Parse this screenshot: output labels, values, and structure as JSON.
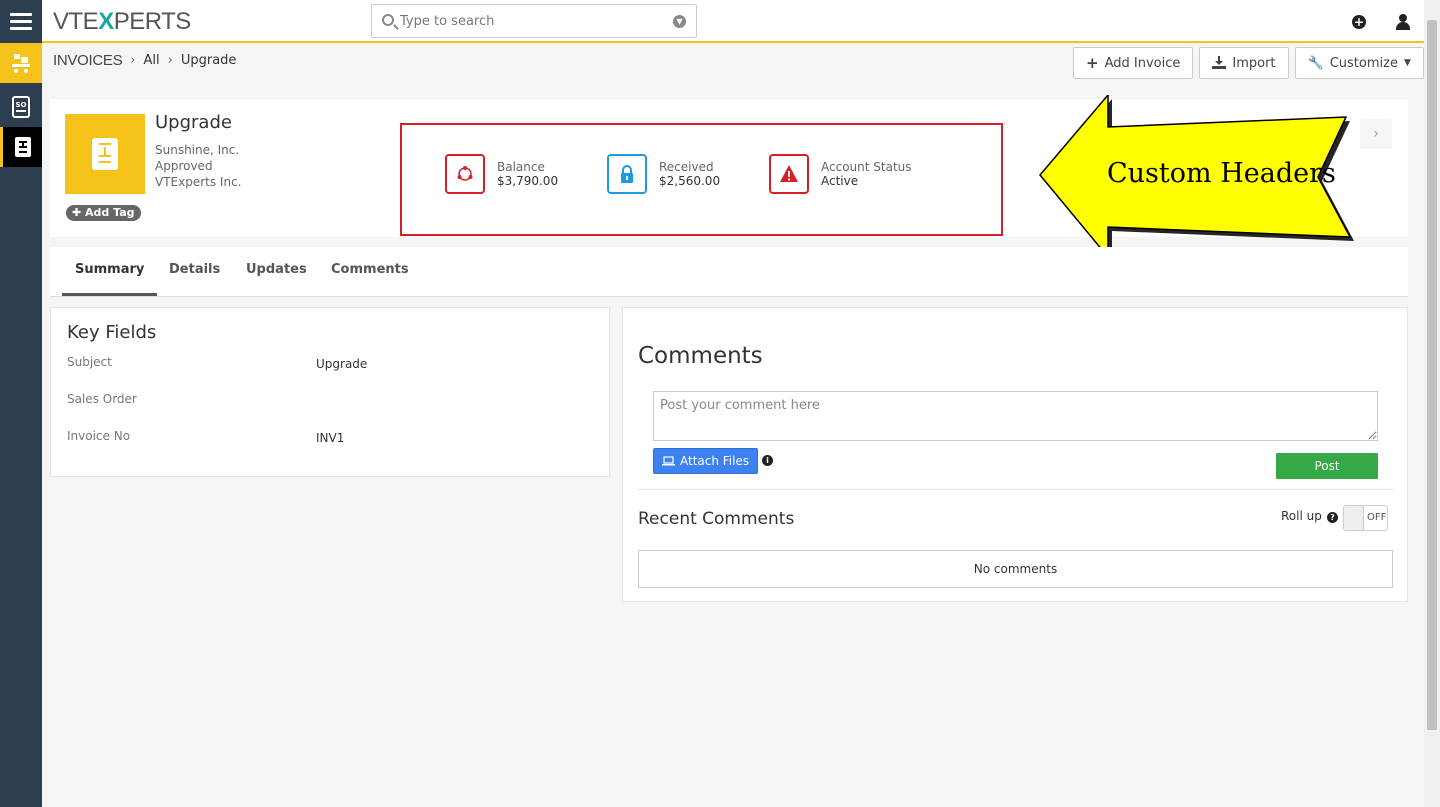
{
  "app": {
    "brand_left": "VTE",
    "brand_x": "X",
    "brand_right": "PERTS"
  },
  "search": {
    "placeholder": "Type to search"
  },
  "breadcrumb": {
    "module": "INVOICES",
    "filter": "All",
    "record": "Upgrade"
  },
  "toolbar": {
    "add_invoice": "Add Invoice",
    "import": "Import",
    "customize": "Customize"
  },
  "record": {
    "name": "Upgrade",
    "account": "Sunshine, Inc.",
    "status": "Approved",
    "organization": "VTExperts Inc.",
    "add_tag": "Add Tag"
  },
  "custom_headers": [
    {
      "label": "Balance",
      "value": "$3,790.00",
      "color": "#d62027",
      "icon": "balance-icon"
    },
    {
      "label": "Received",
      "value": "$2,560.00",
      "color": "#1e9ae0",
      "icon": "lock-icon"
    },
    {
      "label": "Account Status",
      "value": "Active",
      "color": "#d62027",
      "icon": "warning-icon"
    }
  ],
  "annotation": {
    "text": "Custom Headers",
    "fill": "#ffff00"
  },
  "tabs": [
    "Summary",
    "Details",
    "Updates",
    "Comments"
  ],
  "key_fields": {
    "title": "Key Fields",
    "rows": [
      {
        "label": "Subject",
        "value": "Upgrade"
      },
      {
        "label": "Sales Order",
        "value": ""
      },
      {
        "label": "Invoice No",
        "value": "INV1"
      }
    ]
  },
  "comments": {
    "title": "Comments",
    "placeholder": "Post your comment here",
    "attach": "Attach Files",
    "post": "Post",
    "recent_title": "Recent Comments",
    "rollup": "Roll up",
    "toggle": "OFF",
    "empty": "No comments"
  }
}
